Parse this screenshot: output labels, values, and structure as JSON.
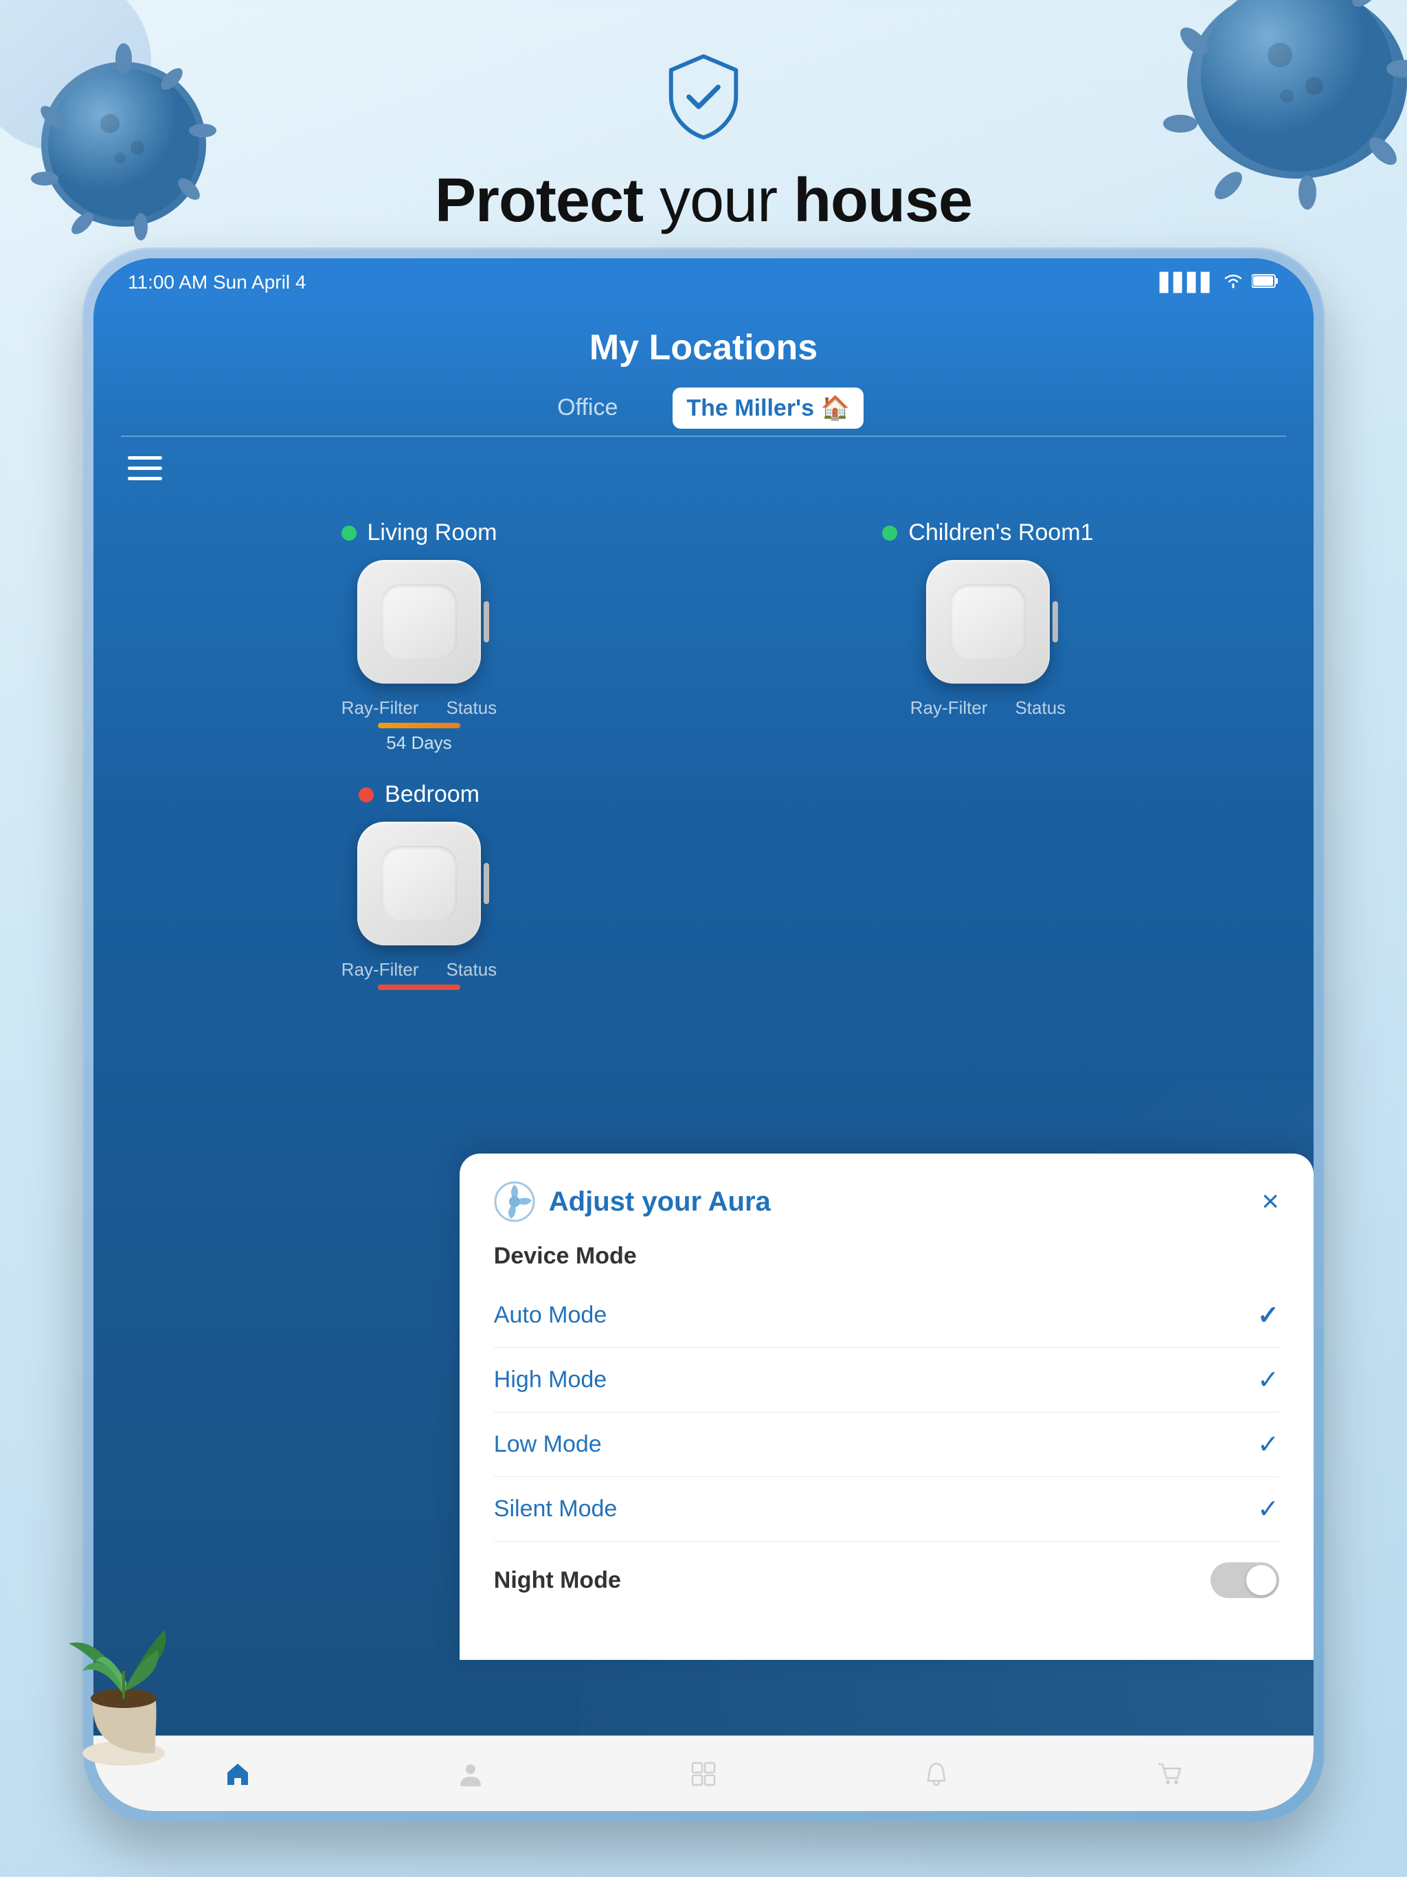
{
  "page": {
    "background_title": "Protect your house",
    "background_title_bold1": "Protect",
    "background_title_bold2": "house"
  },
  "status_bar": {
    "time": "11:00 AM Sun April 4",
    "signal": "▋▋▋▋",
    "wifi": "WiFi",
    "battery": "🔋"
  },
  "app": {
    "title": "My Locations",
    "tabs": [
      {
        "label": "Office",
        "active": false
      },
      {
        "label": "The Miller's 🏠",
        "active": true
      }
    ]
  },
  "rooms": [
    {
      "name": "Living Room",
      "status": "green",
      "filter_label": "Ray-Filter",
      "status_label": "Status",
      "filter_days": "54 Days",
      "bar_color": "yellow"
    },
    {
      "name": "Children's Room1",
      "status": "green",
      "filter_label": "Ray-Filter",
      "status_label": "Status",
      "filter_days": "",
      "bar_color": "none"
    },
    {
      "name": "Bedroom",
      "status": "red",
      "filter_label": "Ray-Filter",
      "status_label": "Status",
      "filter_days": "",
      "bar_color": "red"
    }
  ],
  "modal": {
    "title": "Adjust your Aura",
    "close_label": "×",
    "section_device_mode": "Device Mode",
    "modes": [
      {
        "label": "Auto Mode",
        "active": true
      },
      {
        "label": "High Mode",
        "active": false
      },
      {
        "label": "Low Mode",
        "active": false
      },
      {
        "label": "Silent Mode",
        "active": false
      }
    ],
    "night_mode_label": "Night Mode",
    "night_mode_on": false
  },
  "bottom_tabs": [
    {
      "icon": "home",
      "active": true
    },
    {
      "icon": "person",
      "active": false
    },
    {
      "icon": "grid",
      "active": false
    },
    {
      "icon": "bell",
      "active": false
    },
    {
      "icon": "cart",
      "active": false
    }
  ]
}
